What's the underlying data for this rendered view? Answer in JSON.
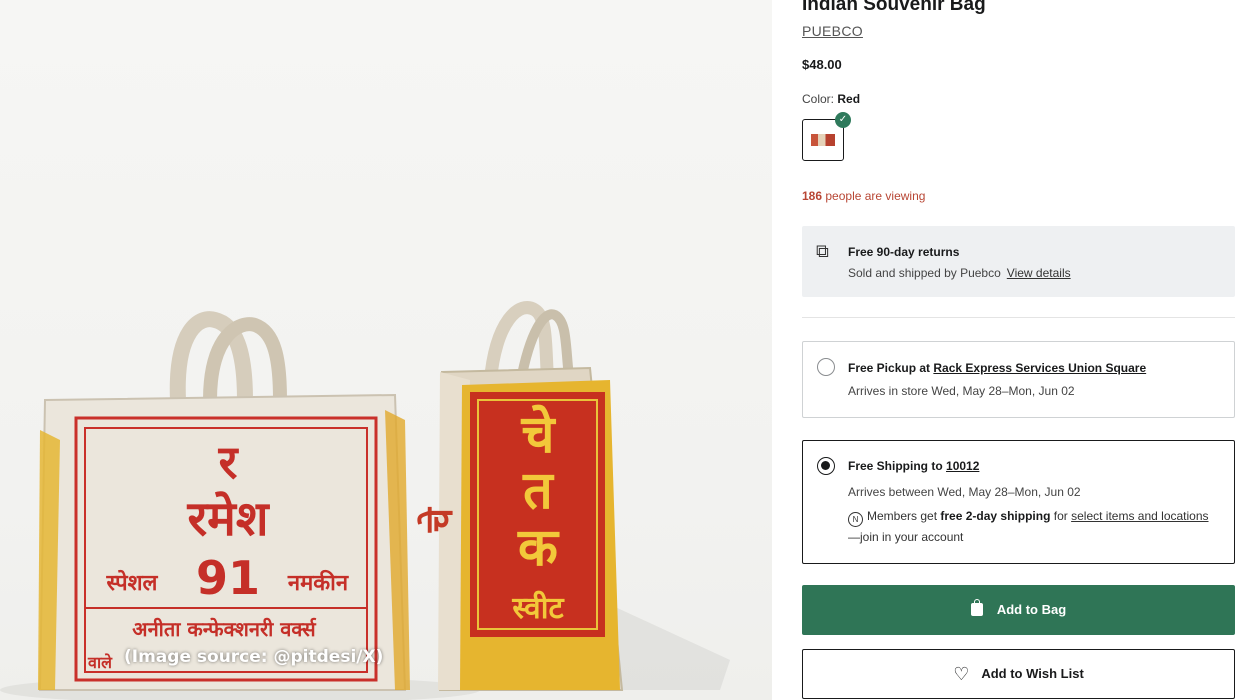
{
  "image": {
    "credit": "(Image source: @pitdesi/X)",
    "left_bag_text": [
      "र",
      "रमेश",
      "91",
      "स्पेशल",
      "नमकीन",
      "अनीता कन्फेक्शनरी वर्क्स",
      "वाले"
    ],
    "right_bag_text": [
      "चे",
      "त",
      "क",
      "स्वीट"
    ]
  },
  "product": {
    "title": "Indian Souvenir Bag",
    "brand": "PUEBCO",
    "price": "$48.00",
    "color_label": "Color:",
    "color_value": "Red",
    "viewing_count": "186",
    "viewing_text": "people are viewing"
  },
  "returns": {
    "title": "Free 90-day returns",
    "sub": "Sold and shipped by Puebco",
    "link": "View details",
    "icon": "box-return-icon"
  },
  "pickup": {
    "title_prefix": "Free Pickup at",
    "store": "Rack Express Services Union Square",
    "arrival": "Arrives in store Wed, May 28–Mon, Jun 02",
    "selected": false
  },
  "shipping": {
    "title_prefix": "Free Shipping to",
    "zip": "10012",
    "arrival": "Arrives between Wed, May 28–Mon, Jun 02",
    "members_prefix": "Members get",
    "members_bold": "free 2-day shipping",
    "members_for": "for",
    "members_link": "select items and locations",
    "members_suffix": "—join in your account",
    "selected": true
  },
  "buttons": {
    "add_to_bag": "Add to Bag",
    "add_to_wishlist": "Add to Wish List"
  },
  "colors": {
    "primary_button": "#2f7556",
    "viewing_text": "#b84634",
    "swatch_check": "#2f7a5c"
  }
}
